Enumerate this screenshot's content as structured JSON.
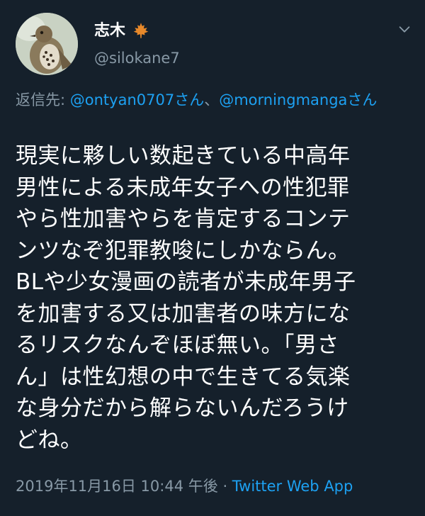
{
  "user": {
    "display_name": "志木",
    "handle": "@silokane7"
  },
  "reply": {
    "prefix": "返信先: ",
    "mention_1": "@ontyan0707さん",
    "separator": "、",
    "mention_2": "@morningmangaさん"
  },
  "tweet": {
    "text": "現実に夥しい数起きている中高年\n男性による未成年女子への性犯罪\nやら性加害やらを肯定するコンテ\nンツなぞ犯罪教唆にしかならん。\nBLや少女漫画の読者が未成年男子\nを加害する又は加害者の味方にな\nるリスクなんぞほぼ無い。「男さ\nん」は性幻想の中で生きてる気楽\nな身分だから解らないんだろうけ\nどね。"
  },
  "meta": {
    "timestamp": "2019年11月16日 10:44 午後",
    "separator": " · ",
    "app": "Twitter Web App"
  },
  "icons": {
    "avatar": "bird-photo-avatar",
    "badge": "maple-leaf-icon",
    "menu": "chevron-down-icon"
  },
  "colors": {
    "background": "#15202b",
    "text": "#ffffff",
    "secondary": "#8899a6",
    "link": "#1da1f2",
    "leaf": "#e8892a"
  }
}
